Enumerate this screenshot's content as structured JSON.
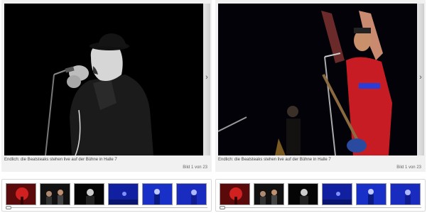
{
  "galleries": [
    {
      "caption": "Endlich: die Beatsteaks stehen live auf der Bühne in Halle 7",
      "counter": "Bild 1 von 23",
      "next_icon": "chevron-right-icon"
    },
    {
      "caption": "Endlich: die Beatsteaks stehen live auf der Bühne in Halle 7",
      "counter": "Bild 1 von 23",
      "next_icon": "chevron-right-icon"
    }
  ],
  "thumbnails": [
    "red stage light",
    "band on stage",
    "singer close-up",
    "blue stage",
    "blue stage guitarist",
    "blue stage crowd"
  ],
  "colors": {
    "panel_bg": "#f1f1f1",
    "photo_bg": "#000000",
    "stage_blue": "#2a3dd8",
    "stage_red": "#c0181a"
  }
}
